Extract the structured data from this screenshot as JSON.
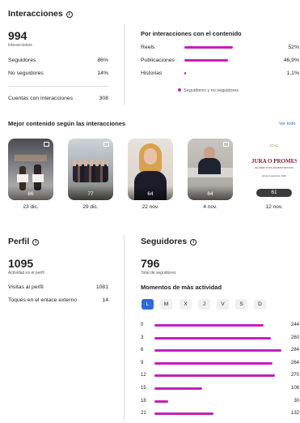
{
  "interactions": {
    "title": "Interacciones",
    "total": "994",
    "total_label": "Interacciones",
    "rows": [
      {
        "label": "Seguidores",
        "value": "86%"
      },
      {
        "label": "No seguidores",
        "value": "14%"
      }
    ],
    "accounts_label": "Cuentas con interacciones",
    "accounts_value": "308"
  },
  "by_content": {
    "title": "Por interacciones con el contenido",
    "rows": [
      {
        "label": "Reels",
        "value": "52%",
        "fraction": 0.52
      },
      {
        "label": "Publicaciones",
        "value": "46,9%",
        "fraction": 0.469
      },
      {
        "label": "Historias",
        "value": "1,1%",
        "fraction": 0.011
      }
    ],
    "legend": "Seguidores y no seguidores"
  },
  "best_content": {
    "title": "Mejor contenido según las interacciones",
    "see_all": "Ver todo",
    "items": [
      {
        "count": "86",
        "date": "23 dic."
      },
      {
        "count": "77",
        "date": "29 dic."
      },
      {
        "count": "64",
        "date": "22 nov."
      },
      {
        "count": "64",
        "date": "4 nov."
      },
      {
        "count": "61",
        "date": "12 nov.",
        "poster_logo": "ICAL",
        "poster_title": "JURA O PROMESA",
        "poster_subtitle": "DE DIRECTIVOS ADMINISTRATIVOS",
        "poster_date": "14 de noviembre 2023"
      }
    ]
  },
  "profile": {
    "title": "Perfil",
    "total": "1095",
    "total_label": "Actividad en el perfil",
    "rows": [
      {
        "label": "Visitas al perfil",
        "value": "1081"
      },
      {
        "label": "Toques en el enlace externo",
        "value": "14"
      }
    ]
  },
  "followers": {
    "title": "Seguidores",
    "total": "796",
    "total_label": "Total de seguidores",
    "moments_title": "Momentos de más actividad",
    "days": [
      "L",
      "M",
      "X",
      "J",
      "V",
      "S",
      "D"
    ],
    "selected_day": "L",
    "hours": [
      {
        "hour": "0",
        "value": "244",
        "n": 244
      },
      {
        "hour": "3",
        "value": "260",
        "n": 260
      },
      {
        "hour": "6",
        "value": "284",
        "n": 284
      },
      {
        "hour": "9",
        "value": "264",
        "n": 264
      },
      {
        "hour": "12",
        "value": "270",
        "n": 270
      },
      {
        "hour": "15",
        "value": "106",
        "n": 106
      },
      {
        "hour": "18",
        "value": "30",
        "n": 30
      },
      {
        "hour": "21",
        "value": "132",
        "n": 132
      }
    ]
  },
  "colors": {
    "bar": "#c51fbd",
    "link": "#2b6ad8",
    "selected_day": "#2b6ad8"
  }
}
